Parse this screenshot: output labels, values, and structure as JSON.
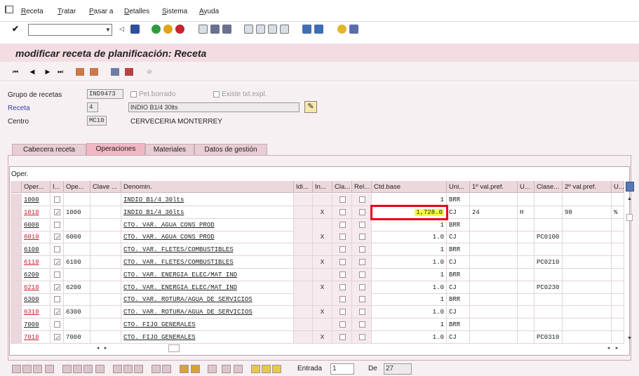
{
  "menu": {
    "items": [
      "Receta",
      "Tratar",
      "Pasar a",
      "Detalles",
      "Sistema",
      "Ayuda"
    ]
  },
  "system_toolbar": {
    "command_field_value": ""
  },
  "title": "modificar receta de planificación: Receta",
  "header": {
    "grupo_label": "Grupo de recetas",
    "grupo_value": "IND9473",
    "pet_borrado_label": "Pet.borrado",
    "existe_txt_label": "Existe txt.expl.",
    "receta_label": "Receta",
    "receta_value": "4",
    "receta_desc": "INDIO B1/4 30lts",
    "centro_label": "Centro",
    "centro_value": "MC10",
    "centro_desc": "CERVECERIA MONTERREY"
  },
  "tabs": [
    "Cabecera receta",
    "Operaciones",
    "Materiales",
    "Datos de gestión"
  ],
  "active_tab": "Operaciones",
  "table": {
    "title": "Oper.",
    "columns": [
      "Oper...",
      "I...",
      "Ope...",
      "Clave ...",
      "Denomin.",
      "Idi...",
      "In...",
      "Cla...",
      "Rel...",
      "Ctd.base",
      "Uni...",
      "1º val.pref.",
      "U...",
      "Clase...",
      "2º val.pref.",
      "U..."
    ],
    "rows": [
      {
        "oper": "1000",
        "i": false,
        "ope": "",
        "denom": "INDIO  B1/4  30lts",
        "in": "",
        "ctd": "1",
        "uni": "BRR",
        "v1": "",
        "u1": "",
        "clase": "",
        "v2": "",
        "u2": "",
        "red": false
      },
      {
        "oper": "1010",
        "i": true,
        "ope": "1000",
        "denom": "INDIO  B1/4  30lts",
        "in": "X",
        "ctd": "1,728.0",
        "uni": "CJ",
        "v1": "24",
        "u1": "H",
        "clase": "",
        "v2": "98",
        "u2": "%",
        "red": true
      },
      {
        "oper": "6000",
        "i": false,
        "ope": "",
        "denom": "CTO. VAR. AGUA CONS PROD",
        "in": "",
        "ctd": "1",
        "uni": "BRR",
        "v1": "",
        "u1": "",
        "clase": "",
        "v2": "",
        "u2": "",
        "red": false
      },
      {
        "oper": "6010",
        "i": true,
        "ope": "6000",
        "denom": "CTO. VAR. AGUA CONS PROD",
        "in": "X",
        "ctd": "1.0",
        "uni": "CJ",
        "v1": "",
        "u1": "",
        "clase": "PC0100",
        "v2": "",
        "u2": "",
        "red": true
      },
      {
        "oper": "6100",
        "i": false,
        "ope": "",
        "denom": "CTO. VAR. FLETES/COMBUSTIBLES",
        "in": "",
        "ctd": "1",
        "uni": "BRR",
        "v1": "",
        "u1": "",
        "clase": "",
        "v2": "",
        "u2": "",
        "red": false
      },
      {
        "oper": "6110",
        "i": true,
        "ope": "6100",
        "denom": "CTO. VAR. FLETES/COMBUSTIBLES",
        "in": "X",
        "ctd": "1.0",
        "uni": "CJ",
        "v1": "",
        "u1": "",
        "clase": "PC0210",
        "v2": "",
        "u2": "",
        "red": true
      },
      {
        "oper": "6200",
        "i": false,
        "ope": "",
        "denom": "CTO. VAR. ENERGIA ELEC/MAT IND",
        "in": "",
        "ctd": "1",
        "uni": "BRR",
        "v1": "",
        "u1": "",
        "clase": "",
        "v2": "",
        "u2": "",
        "red": false
      },
      {
        "oper": "6210",
        "i": true,
        "ope": "6200",
        "denom": "CTO. VAR. ENERGIA ELEC/MAT IND",
        "in": "X",
        "ctd": "1.0",
        "uni": "CJ",
        "v1": "",
        "u1": "",
        "clase": "PC0230",
        "v2": "",
        "u2": "",
        "red": true
      },
      {
        "oper": "6300",
        "i": false,
        "ope": "",
        "denom": "CTO. VAR. ROTURA/AGUA DE SERVICIOS",
        "in": "",
        "ctd": "1",
        "uni": "BRR",
        "v1": "",
        "u1": "",
        "clase": "",
        "v2": "",
        "u2": "",
        "red": false
      },
      {
        "oper": "6310",
        "i": true,
        "ope": "6300",
        "denom": "CTO. VAR. ROTURA/AGUA DE SERVICIOS",
        "in": "X",
        "ctd": "1.0",
        "uni": "CJ",
        "v1": "",
        "u1": "",
        "clase": "",
        "v2": "",
        "u2": "",
        "red": true
      },
      {
        "oper": "7000",
        "i": false,
        "ope": "",
        "denom": "CTO. FIJO GENERALES",
        "in": "",
        "ctd": "1",
        "uni": "BRR",
        "v1": "",
        "u1": "",
        "clase": "",
        "v2": "",
        "u2": "",
        "red": false
      },
      {
        "oper": "7010",
        "i": true,
        "ope": "7000",
        "denom": "CTO. FIJO GENERALES",
        "in": "X",
        "ctd": "1.0",
        "uni": "CJ",
        "v1": "",
        "u1": "",
        "clase": "PC0310",
        "v2": "",
        "u2": "",
        "red": true
      }
    ]
  },
  "footer": {
    "entrada_label": "Entrada",
    "entrada_value": "1",
    "de_label": "De",
    "de_value": "27"
  },
  "colors": {
    "title_bg": "#f3dde3",
    "highlight_border": "#e8001c",
    "highlight_fill": "#f6ff3d",
    "link_red": "#c21d2e"
  }
}
